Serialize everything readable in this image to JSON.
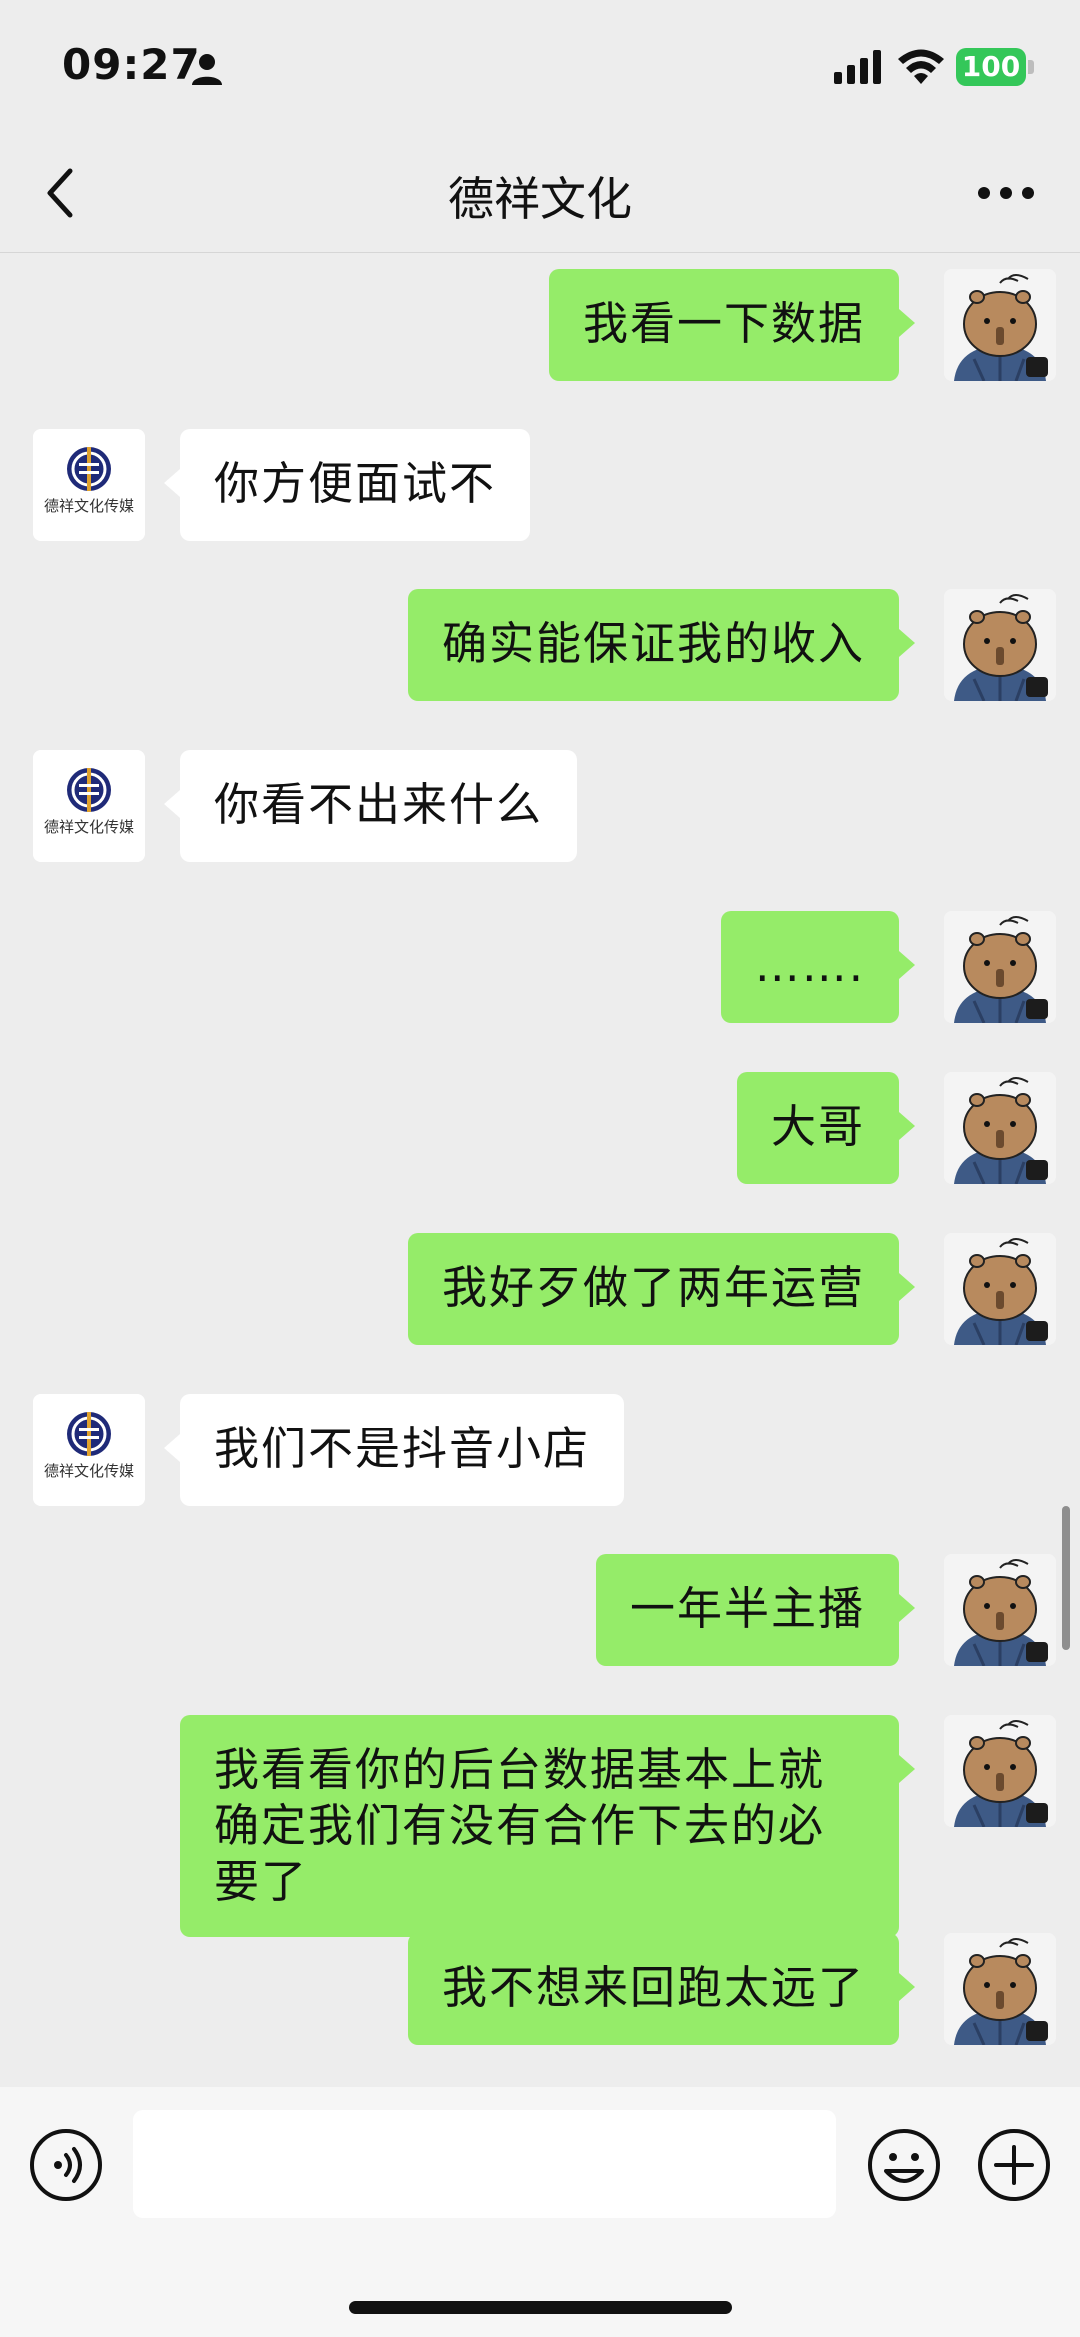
{
  "status_bar": {
    "time": "09:27",
    "battery": "100",
    "battery_color": "#34c759"
  },
  "header": {
    "title": "德祥文化",
    "back_icon": "chevron-left-icon",
    "more_icon": "more-dots-icon"
  },
  "contact_avatar_logo": "德祥文化传媒",
  "colors": {
    "my_bubble": "#95ec69",
    "their_bubble": "#ffffff",
    "background": "#ededed"
  },
  "messages": [
    {
      "sender": "me",
      "text": "我看一下数据"
    },
    {
      "sender": "other",
      "text": "你方便面试不"
    },
    {
      "sender": "me",
      "text": "确实能保证我的收入"
    },
    {
      "sender": "other",
      "text": "你看不出来什么"
    },
    {
      "sender": "me",
      "text": "……."
    },
    {
      "sender": "me",
      "text": "大哥"
    },
    {
      "sender": "me",
      "text": "我好歹做了两年运营"
    },
    {
      "sender": "other",
      "text": "我们不是抖音小店"
    },
    {
      "sender": "me",
      "text": "一年半主播"
    },
    {
      "sender": "me",
      "text": "我看看你的后台数据基本上就确定我们有没有合作下去的必要了"
    },
    {
      "sender": "me",
      "text": "我不想来回跑太远了"
    }
  ],
  "input_bar": {
    "input_value": "",
    "voice_icon": "voice-icon",
    "emoji_icon": "emoji-icon",
    "plus_icon": "plus-icon"
  }
}
